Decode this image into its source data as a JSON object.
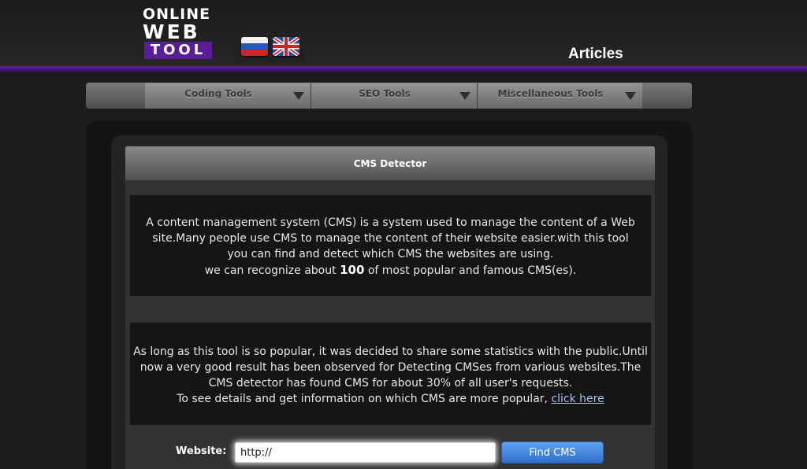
{
  "header": {
    "logo": {
      "line1": "ONLINE",
      "line2": "WEB",
      "line3": "TOOL"
    },
    "languages": [
      "Russian",
      "English"
    ],
    "articles_link": "Articles",
    "accent_color": "#5b1d9a"
  },
  "nav": {
    "items": [
      {
        "label": "Coding Tools"
      },
      {
        "label": "SEO Tools"
      },
      {
        "label": "Miscellaneous Tools"
      }
    ]
  },
  "card": {
    "title": "CMS Detector",
    "intro": {
      "text": "A content management system (CMS) is a system used to manage the content of a Web site.Many people use CMS to manage the content of their website easier.with this tool you can find and detect which CMS the websites are using.",
      "count_prefix": "we can recognize about",
      "count": "100",
      "count_suffix": "of most popular and famous CMS(es)."
    },
    "stats": {
      "text": "As long as this tool is so popular, it was decided to share some statistics with the public.Until now a very good result has been observed for Detecting CMSes from various websites.The CMS detector has found CMS for about 30% of all user's requests.",
      "details_prefix": "To see details and get information on which CMS are more popular,",
      "details_link": "click here"
    }
  },
  "form": {
    "label": "Website:",
    "input_value": "http://",
    "button_label": "Find CMS",
    "button_color": "#3d82de"
  }
}
